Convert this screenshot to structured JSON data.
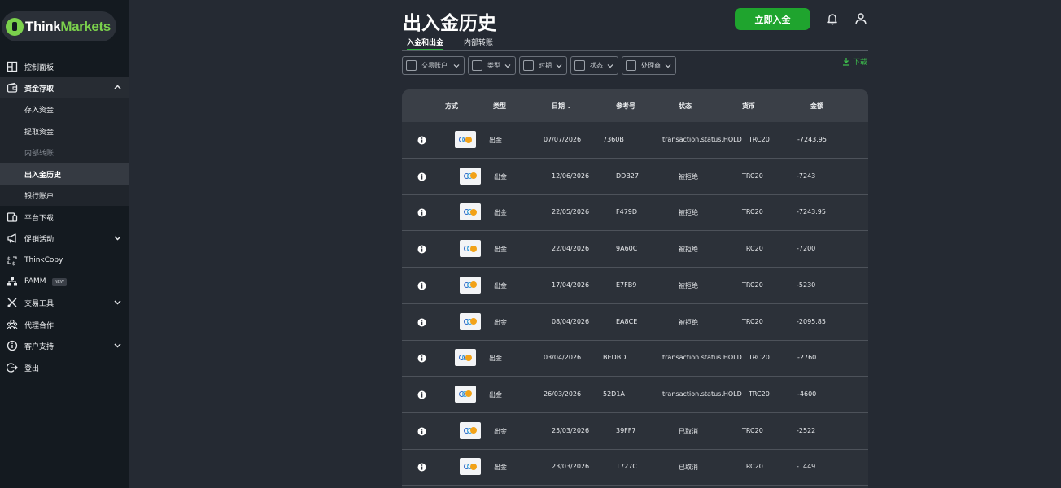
{
  "brand": {
    "think": "Think",
    "markets": "Markets"
  },
  "sidebar": {
    "dashboard": "控制面板",
    "funds": "资金存取",
    "sub": {
      "deposit": "存入资金",
      "withdraw": "提取资金",
      "transfer": "内部转账",
      "history": "出入金历史",
      "bank": "银行账户"
    },
    "platform": "平台下载",
    "promotions": "促销活动",
    "thinkcopy": "ThinkCopy",
    "pamm": "PAMM",
    "pamm_badge": "NEW",
    "tools": "交易工具",
    "partner": "代理合作",
    "support": "客户支持",
    "logout": "登出"
  },
  "header": {
    "title": "出入金历史",
    "deposit_button": "立即入金"
  },
  "tabs": [
    "入金和出金",
    "内部转账"
  ],
  "filters": [
    "交易账户",
    "类型",
    "时期",
    "状态",
    "处理商"
  ],
  "download_label": "下载",
  "table": {
    "headers": {
      "method": "方式",
      "type": "类型",
      "date": "日期",
      "ref": "参考号",
      "status": "状态",
      "currency": "货币",
      "amount": "金额"
    },
    "rows": [
      {
        "type": "出金",
        "date": "07/07/2026",
        "ref": "7360B",
        "status": "transaction.status.HOLD",
        "currency": "TRC20",
        "amount": "-7243.95"
      },
      {
        "type": "出金",
        "date": "12/06/2026",
        "ref": "DDB27",
        "status": "被拒绝",
        "currency": "TRC20",
        "amount": "-7243"
      },
      {
        "type": "出金",
        "date": "22/05/2026",
        "ref": "F479D",
        "status": "被拒绝",
        "currency": "TRC20",
        "amount": "-7243.95"
      },
      {
        "type": "出金",
        "date": "22/04/2026",
        "ref": "9A60C",
        "status": "被拒绝",
        "currency": "TRC20",
        "amount": "-7200"
      },
      {
        "type": "出金",
        "date": "17/04/2026",
        "ref": "E7FB9",
        "status": "被拒绝",
        "currency": "TRC20",
        "amount": "-5230"
      },
      {
        "type": "出金",
        "date": "08/04/2026",
        "ref": "EA8CE",
        "status": "被拒绝",
        "currency": "TRC20",
        "amount": "-2095.85"
      },
      {
        "type": "出金",
        "date": "03/04/2026",
        "ref": "BEDBD",
        "status": "transaction.status.HOLD",
        "currency": "TRC20",
        "amount": "-2760"
      },
      {
        "type": "出金",
        "date": "26/03/2026",
        "ref": "52D1A",
        "status": "transaction.status.HOLD",
        "currency": "TRC20",
        "amount": "-4600"
      },
      {
        "type": "出金",
        "date": "25/03/2026",
        "ref": "39FF7",
        "status": "已取消",
        "currency": "TRC20",
        "amount": "-2522"
      },
      {
        "type": "出金",
        "date": "23/03/2026",
        "ref": "1727C",
        "status": "已取消",
        "currency": "TRC20",
        "amount": "-1449"
      }
    ]
  },
  "colors": {
    "accent": "#1fa42e",
    "brand_green": "#7bd14c",
    "sidebar_bg": "#141a20",
    "page_bg": "#252a33"
  }
}
